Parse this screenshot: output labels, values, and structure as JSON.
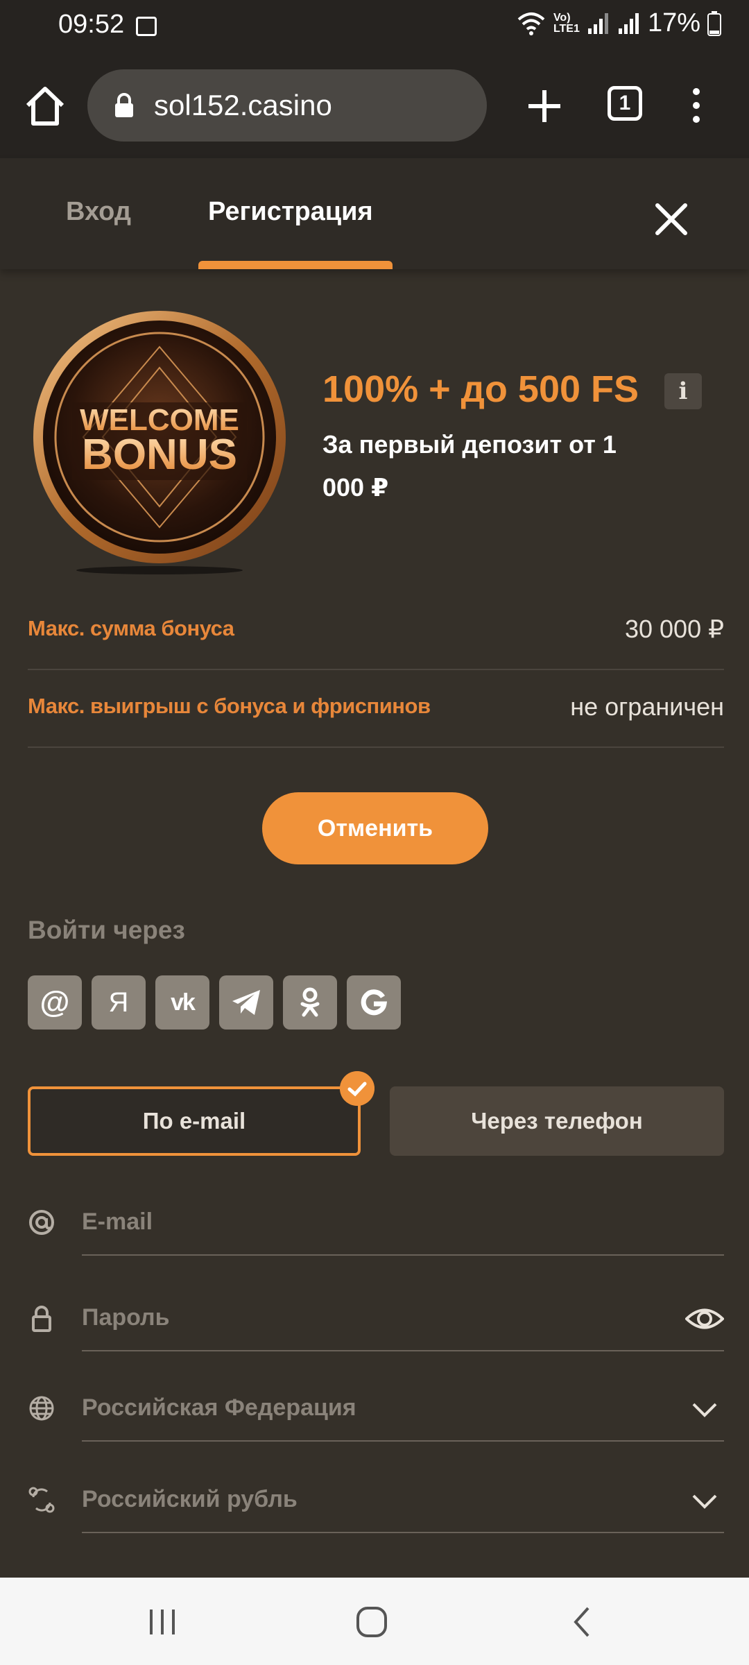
{
  "status_bar": {
    "time": "09:52",
    "network": "Vo) LTE1",
    "battery": "17%",
    "icons": [
      "image-icon",
      "wifi-icon",
      "signal-icon",
      "battery-icon"
    ]
  },
  "browser": {
    "url": "sol152.casino",
    "tab_count": "1",
    "icons": [
      "home-icon",
      "lock-icon",
      "new-tab-icon",
      "tabs-icon",
      "more-menu-icon"
    ]
  },
  "auth_tabs": {
    "login_label": "Вход",
    "register_label": "Регистрация",
    "active": "register"
  },
  "bonus": {
    "image_text": "WELCOME BONUS",
    "title": "100% + до 500 FS",
    "info_label": "i",
    "subtitle": "За первый депозит от 1 000 ₽"
  },
  "details": [
    {
      "label": "Макс. сумма бонуса",
      "value": "30 000 ₽"
    },
    {
      "label": "Макс. выигрыш с бонуса и фриспинов",
      "value": "не ограничен"
    }
  ],
  "cancel_label": "Отменить",
  "login_via": {
    "label": "Войти через",
    "providers": [
      {
        "name": "email",
        "glyph": "@"
      },
      {
        "name": "yandex",
        "glyph": "Я"
      },
      {
        "name": "vk",
        "glyph": "vk"
      },
      {
        "name": "telegram",
        "glyph": ""
      },
      {
        "name": "odnoklassniki",
        "glyph": ""
      },
      {
        "name": "google",
        "glyph": "G"
      }
    ]
  },
  "mode": {
    "email_label": "По e-mail",
    "phone_label": "Через телефон",
    "selected": "email"
  },
  "form": {
    "email_placeholder": "E-mail",
    "password_placeholder": "Пароль",
    "country": "Российская Федерация",
    "currency": "Российский рубль"
  },
  "colors": {
    "accent": "#f0923a",
    "background": "#353029",
    "header": "#2f2b26"
  }
}
